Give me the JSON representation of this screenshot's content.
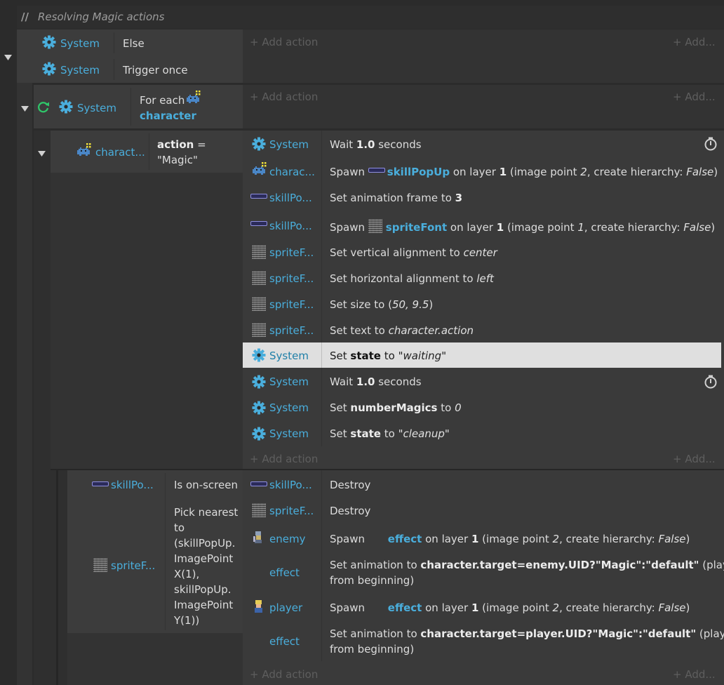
{
  "comment": "Resolving Magic actions",
  "add_action": "Add action",
  "add_short": "Add...",
  "ev1": {
    "conds": [
      {
        "obj": "System",
        "text": "Else"
      },
      {
        "obj": "System",
        "text": "Trigger once"
      }
    ]
  },
  "ev2": {
    "obj": "System",
    "line1": "For each",
    "line2": "character"
  },
  "ev3": {
    "obj": "charact...",
    "cond_bold": "action",
    "cond_eq": " =",
    "cond_val": "\"Magic\""
  },
  "ev3_actions": [
    {
      "obj": "System",
      "p1": "Wait ",
      "b1": "1.0",
      "p2": " seconds"
    },
    {
      "obj": "charac...",
      "p1": "Spawn ",
      "bb": "skillPopUp",
      "p2": " on layer ",
      "b1": "1",
      "p3": " (image point ",
      "i1": "2",
      "p4": ", create hierarchy: ",
      "i2": "False",
      "p5": ")"
    },
    {
      "obj": "skillPo...",
      "p1": "Set animation frame to ",
      "b1": "3"
    },
    {
      "obj": "skillPo...",
      "p1": "Spawn ",
      "bb": "spriteFont",
      "p2": " on layer ",
      "b1": "1",
      "p3": " (image point ",
      "i1": "1",
      "p4": ", create hierarchy: ",
      "i2": "False",
      "p5": ")"
    },
    {
      "obj": "spriteF...",
      "p1": "Set vertical alignment to ",
      "i1": "center"
    },
    {
      "obj": "spriteF...",
      "p1": "Set horizontal alignment to ",
      "i1": "left"
    },
    {
      "obj": "spriteF...",
      "p1": "Set size to (",
      "i1": "50, 9.5",
      "p2": ")"
    },
    {
      "obj": "spriteF...",
      "p1": "Set text to ",
      "i1": "character.action"
    },
    {
      "obj": "System",
      "p1": "Set ",
      "b1": "state",
      "p2": " to ",
      "i1": "\"waiting\""
    },
    {
      "obj": "System",
      "p1": "Wait ",
      "b1": "1.0",
      "p2": " seconds"
    },
    {
      "obj": "System",
      "p1": "Set ",
      "b1": "numberMagics",
      "p2": " to ",
      "i1": "0"
    },
    {
      "obj": "System",
      "p1": "Set ",
      "b1": "state",
      "p2": " to ",
      "i1": "\"cleanup\""
    }
  ],
  "ev4": {
    "cond1_obj": "skillPo...",
    "cond1_text": "Is on-screen",
    "cond2_obj": "spriteF...",
    "cond2_lines": [
      "Pick nearest",
      "to",
      "(skillPopUp.",
      "ImagePoint",
      "X(1),",
      "skillPopUp.",
      "ImagePoint",
      "Y(1))"
    ]
  },
  "ev4_actions": [
    {
      "obj": "skillPo...",
      "p1": "Destroy"
    },
    {
      "obj": "spriteF...",
      "p1": "Destroy"
    },
    {
      "obj": "enemy",
      "p1": "Spawn ",
      "bb": "effect",
      "p2": " on layer ",
      "b1": "1",
      "p3": " (image point ",
      "i1": "2",
      "p4": ", create hierarchy: ",
      "i2": "False",
      "p5": ")"
    },
    {
      "obj": "effect",
      "p1": "Set animation to ",
      "b1": "character.target=enemy.UID?\"Magic\":\"default\"",
      "p2": " (play",
      "line2": "from beginning)"
    },
    {
      "obj": "player",
      "p1": "Spawn ",
      "bb": "effect",
      "p2": " on layer ",
      "b1": "1",
      "p3": " (image point ",
      "i1": "2",
      "p4": ", create hierarchy: ",
      "i2": "False",
      "p5": ")"
    },
    {
      "obj": "effect",
      "p1": "Set animation to ",
      "b1": "character.target=player.UID?\"Magic\":\"default\"",
      "p2": " (play",
      "line2": "from beginning)"
    }
  ]
}
